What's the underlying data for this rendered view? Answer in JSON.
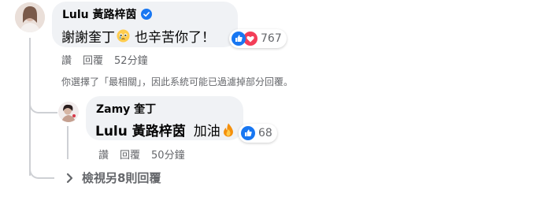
{
  "comment": {
    "author": "Lulu 黃路梓茵",
    "text_prefix": "謝謝奎丁",
    "text_suffix": "也辛苦你了！",
    "reaction_count": "767",
    "actions": {
      "like": "讚",
      "reply": "回覆",
      "time": "52分鐘"
    },
    "filter_note": "你選擇了「最相關」，因此系統可能已過濾掉部分回覆。"
  },
  "reply": {
    "author": "Zamy 奎丁",
    "mention": "Lulu 黃路梓茵",
    "text": "加油",
    "reaction_count": "68",
    "actions": {
      "like": "讚",
      "reply": "回覆",
      "time": "50分鐘"
    }
  },
  "view_more": "檢視另8則回覆",
  "colors": {
    "bubble": "#f0f2f5",
    "like_blue": "#1877f2",
    "love_red": "#f33e58",
    "muted": "#65676b"
  }
}
